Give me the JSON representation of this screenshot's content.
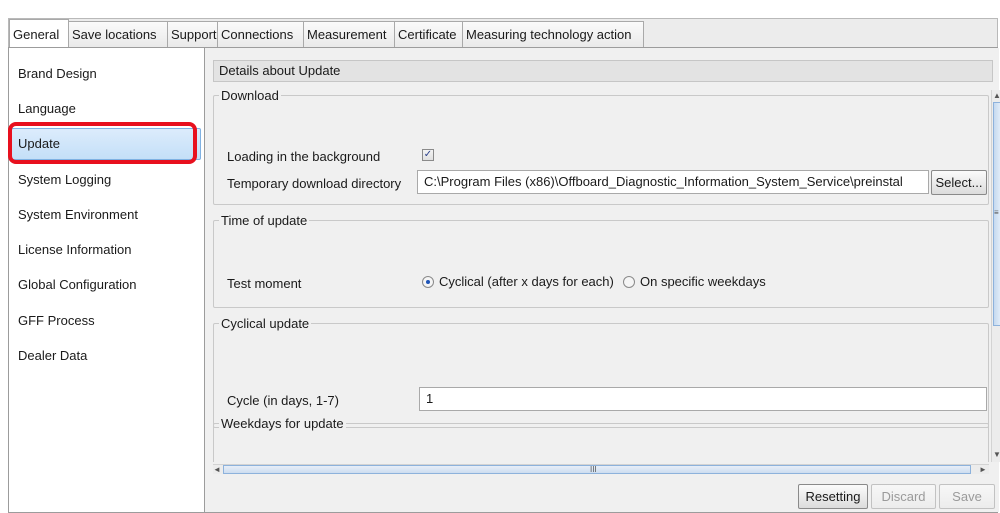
{
  "tabs": [
    {
      "label": "General",
      "active": true
    },
    {
      "label": "Save locations",
      "active": false
    },
    {
      "label": "Support",
      "active": false
    },
    {
      "label": "Connections",
      "active": false
    },
    {
      "label": "Measurement",
      "active": false
    },
    {
      "label": "Certificate",
      "active": false
    },
    {
      "label": "Measuring technology action",
      "active": false
    }
  ],
  "sidebar": {
    "items": [
      {
        "label": "Brand Design"
      },
      {
        "label": "Language"
      },
      {
        "label": "Update",
        "selected": true
      },
      {
        "label": "System Logging"
      },
      {
        "label": "System Environment"
      },
      {
        "label": "License Information"
      },
      {
        "label": "Global Configuration"
      },
      {
        "label": "GFF Process"
      },
      {
        "label": "Dealer Data"
      }
    ]
  },
  "content": {
    "header": "Details about Update",
    "download": {
      "title": "Download",
      "loading_label": "Loading in the background",
      "loading_checked": true,
      "checkmark": "✓",
      "dir_label": "Temporary download directory",
      "dir_value": "C:\\Program Files (x86)\\Offboard_Diagnostic_Information_System_Service\\preinstal",
      "select_button": "Select..."
    },
    "time_of_update": {
      "title": "Time of update",
      "test_moment_label": "Test moment",
      "option_cyclical": "Cyclical (after x days for each)",
      "option_weekdays": "On specific weekdays",
      "selected": "cyclical"
    },
    "cyclical_update": {
      "title": "Cyclical update",
      "cycle_label": "Cycle (in days, 1-7)",
      "cycle_value": "1"
    },
    "weekdays": {
      "title": "Weekdays for update"
    }
  },
  "scrollbars": {
    "up_arrow": "▲",
    "down_arrow": "▼",
    "left_arrow": "◄",
    "right_arrow": "►",
    "h_grip": "III",
    "v_grip": "≡"
  },
  "footer": {
    "reset_button": "Resetting",
    "discard_button": "Discard",
    "save_button": "Save"
  },
  "colors": {
    "highlight": "#e8101e",
    "selection": "#c4dff8"
  }
}
